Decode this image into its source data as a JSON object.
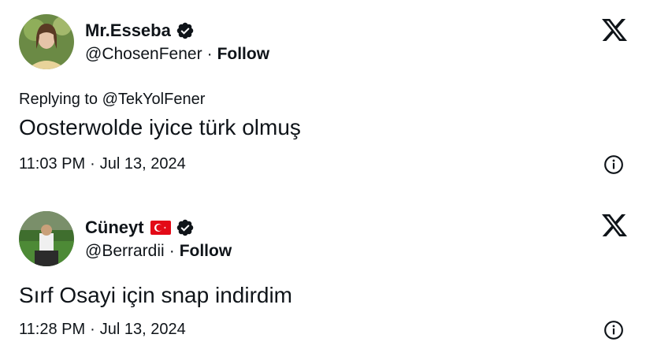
{
  "tweets": [
    {
      "display_name": "Mr.Esseba",
      "verified": true,
      "handle": "@ChosenFener",
      "follow_label": "Follow",
      "separator": "·",
      "replying_to": "Replying to @TekYolFener",
      "text": "Oosterwolde iyice türk olmuş",
      "time": "11:03 PM",
      "date": "Jul 13, 2024",
      "avatar_icon": "avatar-photo-woman"
    },
    {
      "display_name": "Cüneyt",
      "flag_icon": "turkey-flag-icon",
      "verified": true,
      "handle": "@Berrardii",
      "follow_label": "Follow",
      "separator": "·",
      "text": "Sırf Osayi için snap indirdim",
      "time": "11:28 PM",
      "date": "Jul 13, 2024",
      "avatar_icon": "avatar-photo-stadium"
    }
  ],
  "colors": {
    "text": "#0f1419",
    "verified_badge": "#0f1419",
    "flag_red": "#e30a17"
  }
}
